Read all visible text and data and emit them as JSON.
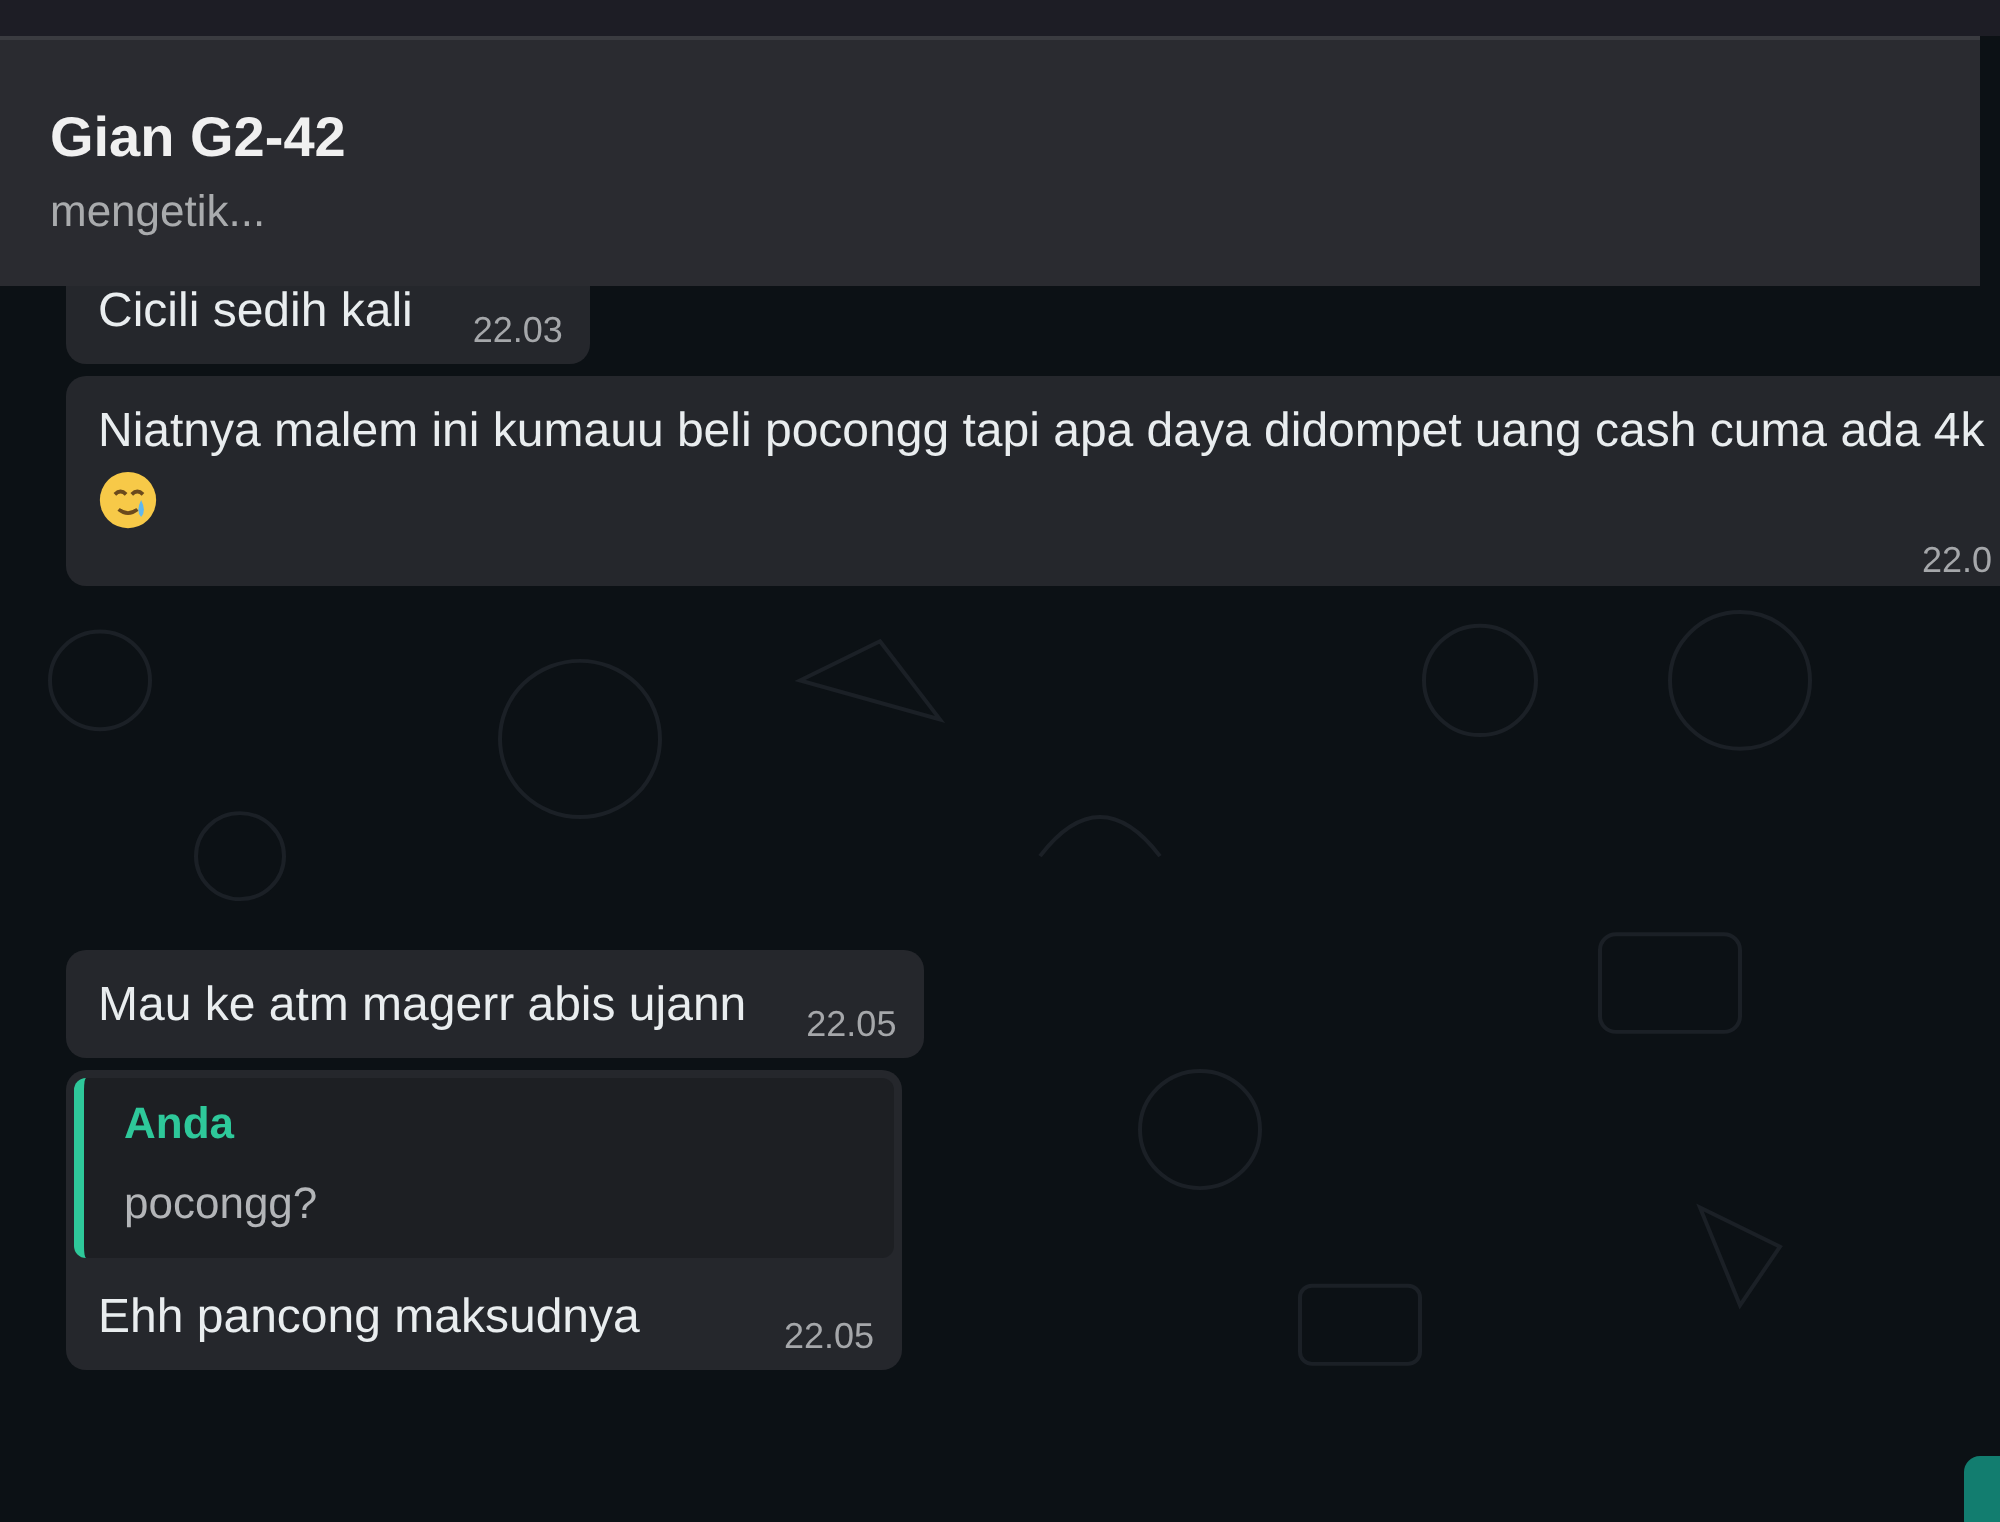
{
  "chat_header": {
    "title": "Gian G2-42",
    "status": "mengetik..."
  },
  "messages": [
    {
      "kind": "plain",
      "text": "Cicili sedih kali",
      "time": "22.03"
    },
    {
      "kind": "emoji_tail",
      "text": "Niatnya malem ini kumauu beli pocongg tapi apa daya didompet uang cash cuma ada 4k",
      "time": "22.0"
    },
    {
      "kind": "gap"
    },
    {
      "kind": "plain",
      "text": "Mau ke atm magerr abis ujann",
      "time": "22.05"
    },
    {
      "kind": "reply",
      "quote_author": "Anda",
      "quote_text": "pocongg?",
      "text": "Ehh pancong maksudnya",
      "time": "22.05"
    }
  ]
}
